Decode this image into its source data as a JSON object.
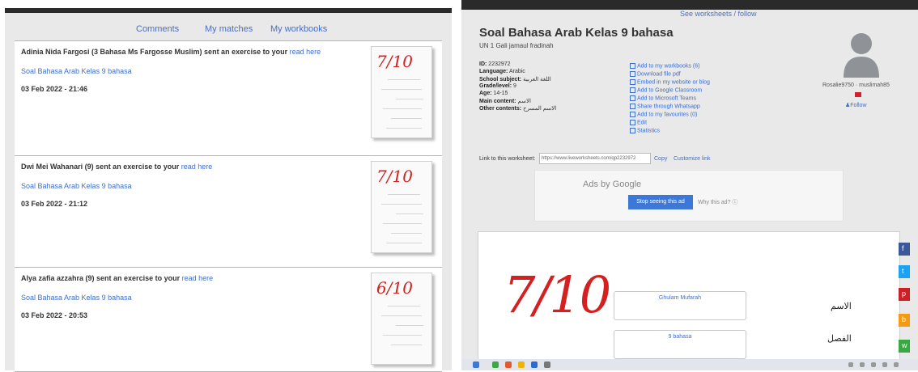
{
  "left": {
    "tabs": [
      "Comments",
      "My matches",
      "My workbooks"
    ],
    "cards": [
      {
        "sender": "Adinia Nida Fargosi (3 Bahasa Ms Fargosse Muslim) sent an exercise to your",
        "link_text": "read here",
        "worksheet": "Soal Bahasa Arab Kelas 9 bahasa",
        "date": "03 Feb 2022 - 21:46",
        "score": "7/10"
      },
      {
        "sender": "Dwi Mei Wahanari (9) sent an exercise to your",
        "link_text": "read here",
        "worksheet": "Soal Bahasa Arab Kelas 9 bahasa",
        "date": "03 Feb 2022 - 21:12",
        "score": "7/10"
      },
      {
        "sender": "Alya zafia azzahra (9) sent an exercise to your",
        "link_text": "read here",
        "worksheet": "Soal Bahasa Arab Kelas 9 bahasa",
        "date": "03 Feb 2022 - 20:53",
        "score": "6/10"
      }
    ]
  },
  "right": {
    "top_link": "See worksheets / follow",
    "title": "Soal Bahasa Arab Kelas 9 bahasa",
    "author": "UN 1 Gali jamaul fradinah",
    "meta": [
      {
        "label": "ID:",
        "value": "2232972"
      },
      {
        "label": "Language:",
        "value": "Arabic"
      },
      {
        "label": "School subject:",
        "value": "اللغة العربية"
      },
      {
        "label": "Grade/level:",
        "value": "9"
      },
      {
        "label": "Age:",
        "value": "14-15"
      },
      {
        "label": "Main content:",
        "value": "الاسم"
      },
      {
        "label": "Other contents:",
        "value": "الاسم المسرح"
      }
    ],
    "actions": [
      "Add to my workbooks (6)",
      "Download file pdf",
      "Embed in my website or blog",
      "Add to Google Classroom",
      "Add to Microsoft Teams",
      "Share through Whatsapp",
      "Add to my favourites (0)",
      "Edit",
      "Statistics"
    ],
    "username": "Rosalie9750 · muslimah85",
    "follow": "Follow",
    "link_label": "Link to this worksheet:",
    "link_url": "https://www.liveworksheets.com/qp2232972",
    "copy": "Copy",
    "customize": "Customize link",
    "ad": {
      "google": "Ads by Google",
      "stop": "Stop seeing this ad",
      "why": "Why this ad? ⓘ"
    },
    "sheet": {
      "score": "7/10",
      "field1": "Ghulam Mufarah",
      "field2": "9 bahasa",
      "label1": "الاسم",
      "label2": "الفصل"
    },
    "social_colors": [
      "#3b5998",
      "#1da1f2",
      "#cb2027",
      "#f39c12",
      "#3aa843"
    ],
    "social_icons": [
      "f",
      "t",
      "p",
      "b",
      "w"
    ]
  }
}
